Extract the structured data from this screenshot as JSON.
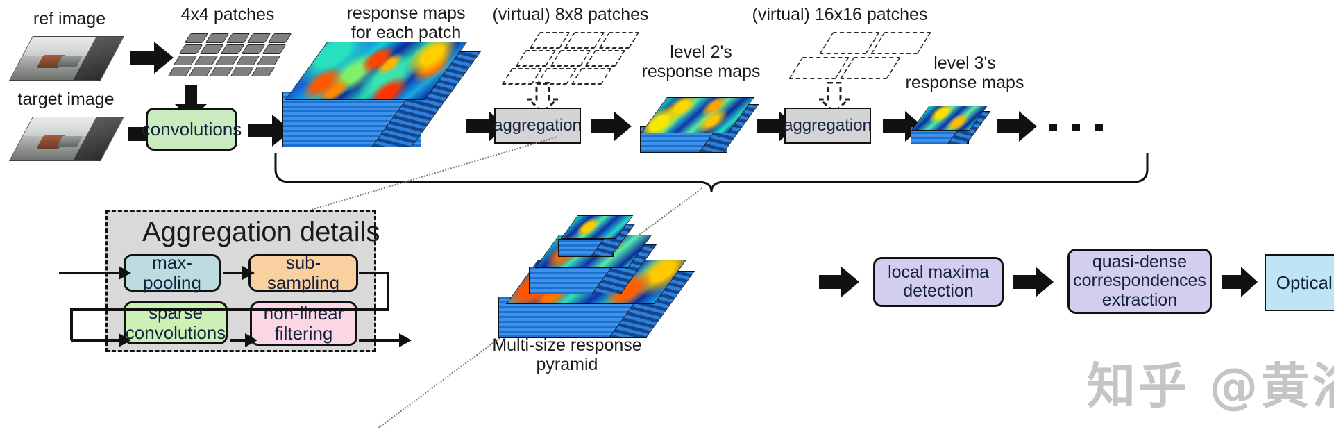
{
  "figure": {
    "domain": "diagram",
    "watermark": "知乎 @黄浴"
  },
  "labels": {
    "ref_image": "ref image",
    "target_image": "target image",
    "patches_4x4": "4x4 patches",
    "response_maps_each_patch": "response maps\nfor each patch",
    "virtual_8x8": "(virtual) 8x8 patches",
    "level2_maps": "level 2's\nresponse maps",
    "virtual_16x16": "(virtual) 16x16 patches",
    "level3_maps": "level 3's\nresponse maps",
    "pyramid_caption": "Multi-size response pyramid",
    "aggregation_details": "Aggregation details",
    "ellipsis": "..."
  },
  "boxes": {
    "convolutions": {
      "label": "convolutions",
      "color": "#c8ecc0"
    },
    "aggregation_1": {
      "label": "aggregation",
      "color": "#d4d4d4"
    },
    "aggregation_2": {
      "label": "aggregation",
      "color": "#d4d4d4"
    },
    "max_pooling": {
      "label": "max-pooling",
      "color": "#bcdcdf"
    },
    "sub_sampling": {
      "label": "sub-sampling",
      "color": "#fbd0a0"
    },
    "sparse_convolutions": {
      "label": "sparse\nconvolutions",
      "color": "#cdf0b4"
    },
    "non_linear_filtering": {
      "label": "non-linear\nfiltering",
      "color": "#fbd6e4"
    },
    "local_maxima_detection": {
      "label": "local maxima\ndetection",
      "color": "#d3cdef"
    },
    "quasi_dense": {
      "label": "quasi-dense\ncorrespondences\nextraction",
      "color": "#d3cdef"
    },
    "optical_flow": {
      "label": "Optical flow",
      "color": "#bfe4f6"
    }
  },
  "colors": {
    "outline": "#111111",
    "heat_low": "#0b2fa0",
    "heat_mid": "#2fe0c8",
    "heat_high": "#ff3b00",
    "stack_side": "#2f86de",
    "panel_gray": "#d9d9d9"
  },
  "flow": {
    "top_pipeline": [
      "ref image",
      "4x4 patches",
      "convolutions",
      "response maps for each patch",
      "aggregation",
      "level 2's response maps",
      "aggregation",
      "level 3's response maps",
      "..."
    ],
    "bottom_pipeline": [
      "Multi-size response pyramid",
      "local maxima detection",
      "quasi-dense correspondences extraction",
      "Optical flow"
    ],
    "aggregation_detail_pipeline": [
      "max-pooling",
      "sub-sampling",
      "sparse convolutions",
      "non-linear filtering"
    ]
  }
}
